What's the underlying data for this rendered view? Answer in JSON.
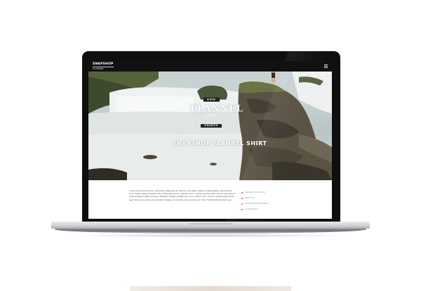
{
  "site": {
    "logo": "SNAPSHOP",
    "logo_sub": "FLANNEL",
    "menu_icon": "hamburger-menu-icon"
  },
  "hero": {
    "badge_top": "NEW",
    "badge_title": "FLANNEL",
    "badge_collection": "collection",
    "badge_bottom": "SHIRTS",
    "heading": "SNAPSHOP FLANNEL SHIRT",
    "subtext": "Lorem ipsum dolor sit amet, consectetur adipiscing elit. Sed hendrerit."
  },
  "content": {
    "article": "Lorem ipsum dolor sit amet, consectetur adipiscing elit. Sed hec nich fugiat. Nullam eu blandit ligula, vitae faucibus enim. Nullam eleifend tincidunt odio. Nullam ligula ipsum, gravida id est a, egestas pulvinar lacus. Donec eget tellus ac neque tristique sodales vel quam. Phasellus feugiat convallis risus, lorem ultrices odio. Vivamus massa condimentum eget. Donec nec velit eu eros interdum tristique, in vulputate enim sit amet nunc. Nunc fringilla nulla dignissim sed.",
    "sidebar": [
      "SUMMER COLLECTION",
      "NEW LOOK",
      "WINTER FASHION TRENDS",
      "ACCESSORIES"
    ]
  }
}
